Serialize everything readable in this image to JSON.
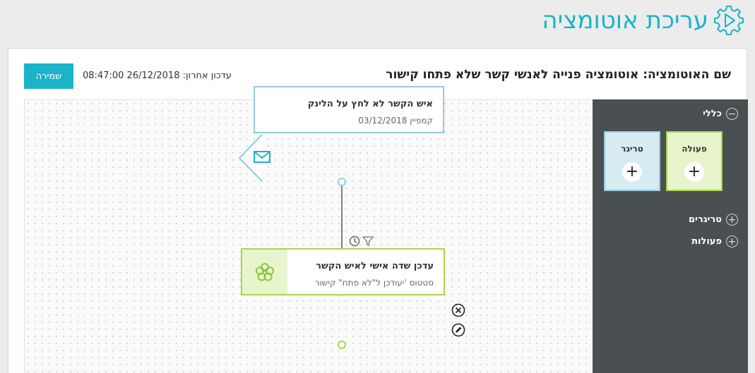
{
  "header": {
    "title": "עריכת אוטומציה"
  },
  "toolbar": {
    "automation_name": "שם האוטומציה: אוטומציה פנייה לאנשי קשר שלא פתחו קישור",
    "last_update": "עדכון אחרון: 26/12/2018 08:47:00",
    "save_label": "שמירה"
  },
  "sidebar": {
    "general": "כללי",
    "action_tile": "פעולה",
    "trigger_tile": "טריגר",
    "triggers": "טריגרים",
    "actions": "פעולות"
  },
  "canvas": {
    "trigger": {
      "title": "איש הקשר לא לחץ על הלינק",
      "subtitle": "קמפיין 03/12/2018"
    },
    "action": {
      "title": "עדכן שדה אישי לאיש הקשר",
      "subtitle": "סטטוס 'יעודכן ל\"לא פתח\" קישור"
    }
  },
  "colors": {
    "accent": "#1ab3c8",
    "trigger_border": "#93ccdf",
    "action_border": "#a9d54a",
    "sidebar_bg": "#4a4f52"
  }
}
